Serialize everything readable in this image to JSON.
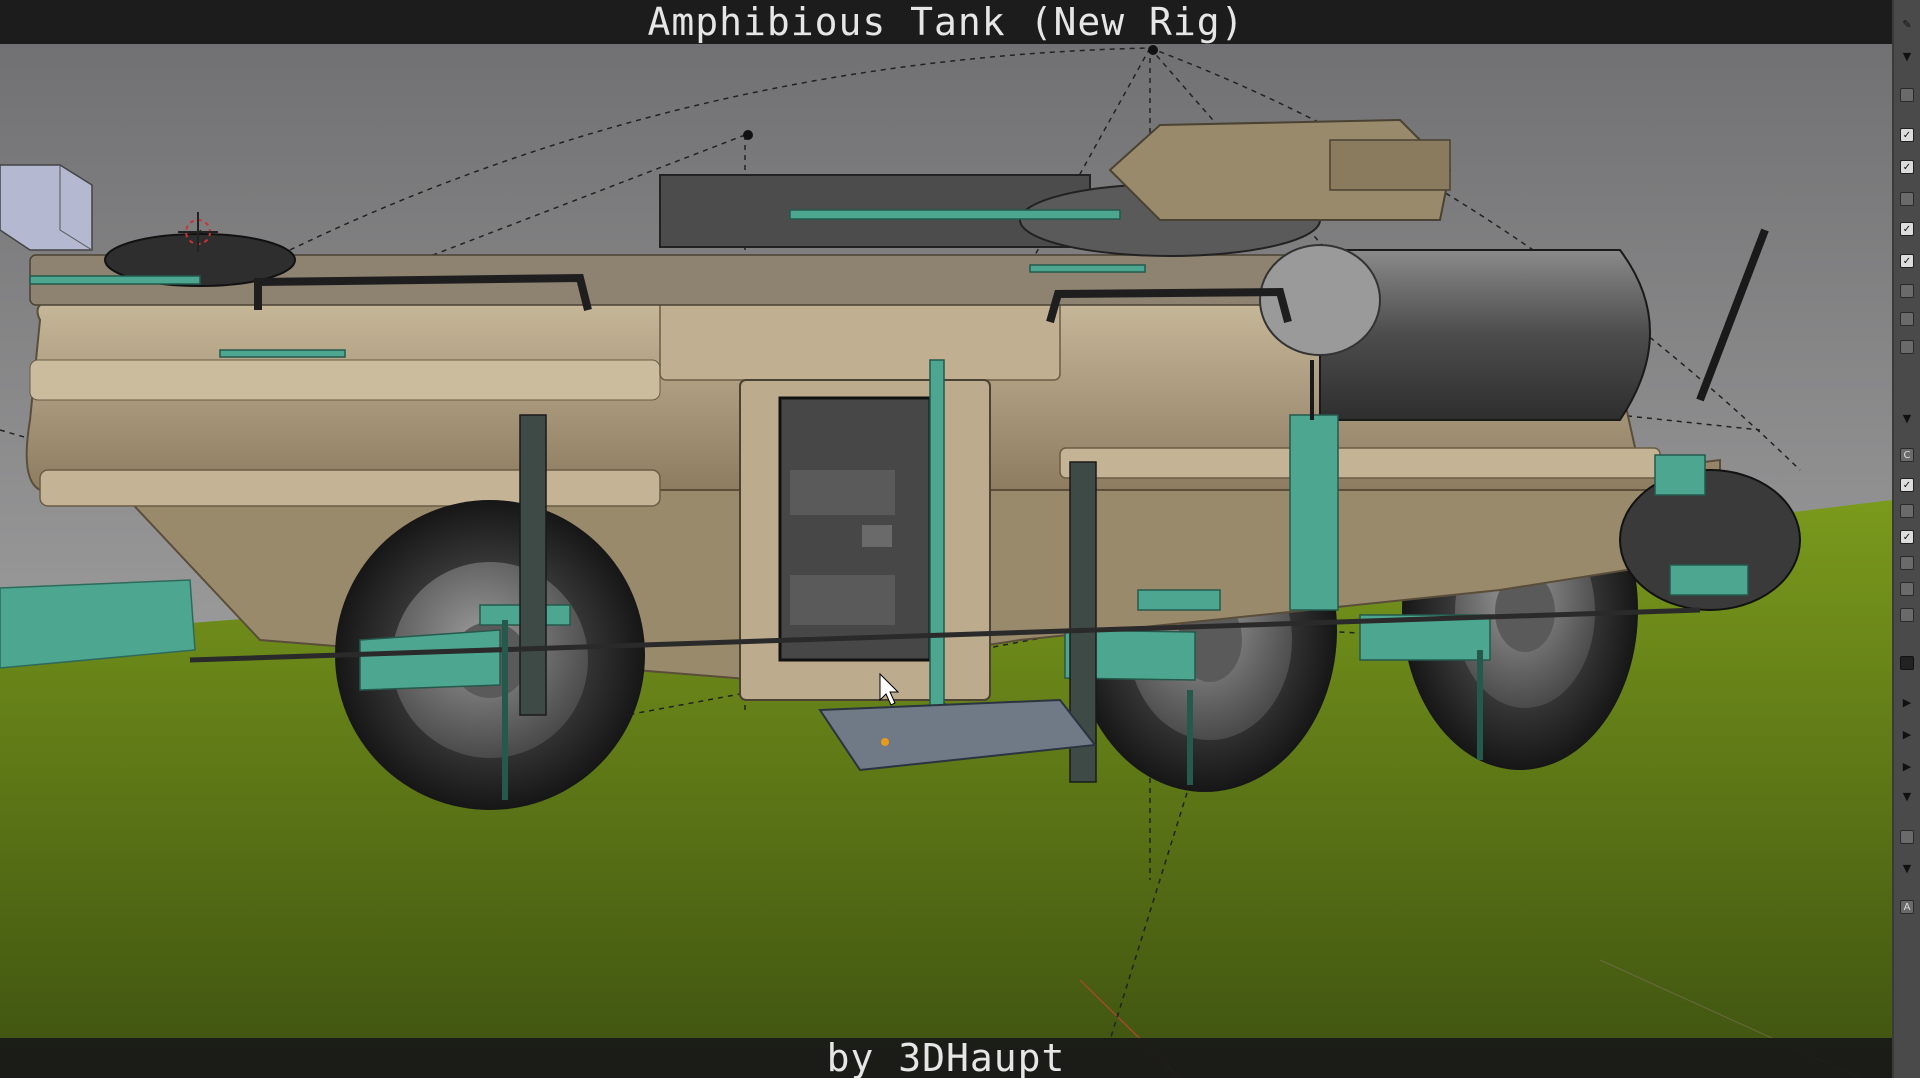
{
  "window": {
    "title": "Amphibious Tank (New Rig)",
    "credit": "by 3DHaupt"
  },
  "viewport": {
    "colors": {
      "sky_top": "#6e6e70",
      "sky_bottom": "#b8b8b8",
      "ground_light": "#7a9a1c",
      "ground_dark": "#3e5210",
      "hull": "#b7a586",
      "hull_shadow": "#8d7c60",
      "rig_control": "#4da790",
      "tire": "#2a2a2a",
      "metal": "#5e5e5e"
    },
    "icons": [
      "3d-cursor-icon",
      "mouse-cursor-icon",
      "empty-object-icon"
    ]
  },
  "properties_panel": {
    "controls": [
      {
        "kind": "icon",
        "icon": "wrench-icon",
        "glyph": "✎"
      },
      {
        "kind": "triangle",
        "glyph": "▼"
      },
      {
        "kind": "box",
        "glyph": ""
      },
      {
        "kind": "check",
        "glyph": "✓"
      },
      {
        "kind": "check",
        "glyph": "✓"
      },
      {
        "kind": "box",
        "glyph": ""
      },
      {
        "kind": "check",
        "glyph": "✓"
      },
      {
        "kind": "check",
        "glyph": "✓"
      },
      {
        "kind": "box",
        "glyph": ""
      },
      {
        "kind": "box",
        "glyph": ""
      },
      {
        "kind": "box",
        "glyph": ""
      },
      {
        "kind": "triangle",
        "glyph": "▼"
      },
      {
        "kind": "box",
        "glyph": "C"
      },
      {
        "kind": "check",
        "glyph": "✓"
      },
      {
        "kind": "box",
        "glyph": ""
      },
      {
        "kind": "check",
        "glyph": "✓"
      },
      {
        "kind": "box",
        "glyph": ""
      },
      {
        "kind": "box",
        "glyph": ""
      },
      {
        "kind": "box",
        "glyph": ""
      },
      {
        "kind": "dark",
        "glyph": ""
      },
      {
        "kind": "triangle",
        "glyph": "▶"
      },
      {
        "kind": "triangle",
        "glyph": "▶"
      },
      {
        "kind": "triangle",
        "glyph": "▶"
      },
      {
        "kind": "triangle",
        "glyph": "▼"
      },
      {
        "kind": "box",
        "glyph": ""
      },
      {
        "kind": "triangle",
        "glyph": "▼"
      },
      {
        "kind": "box",
        "glyph": "A"
      }
    ]
  }
}
